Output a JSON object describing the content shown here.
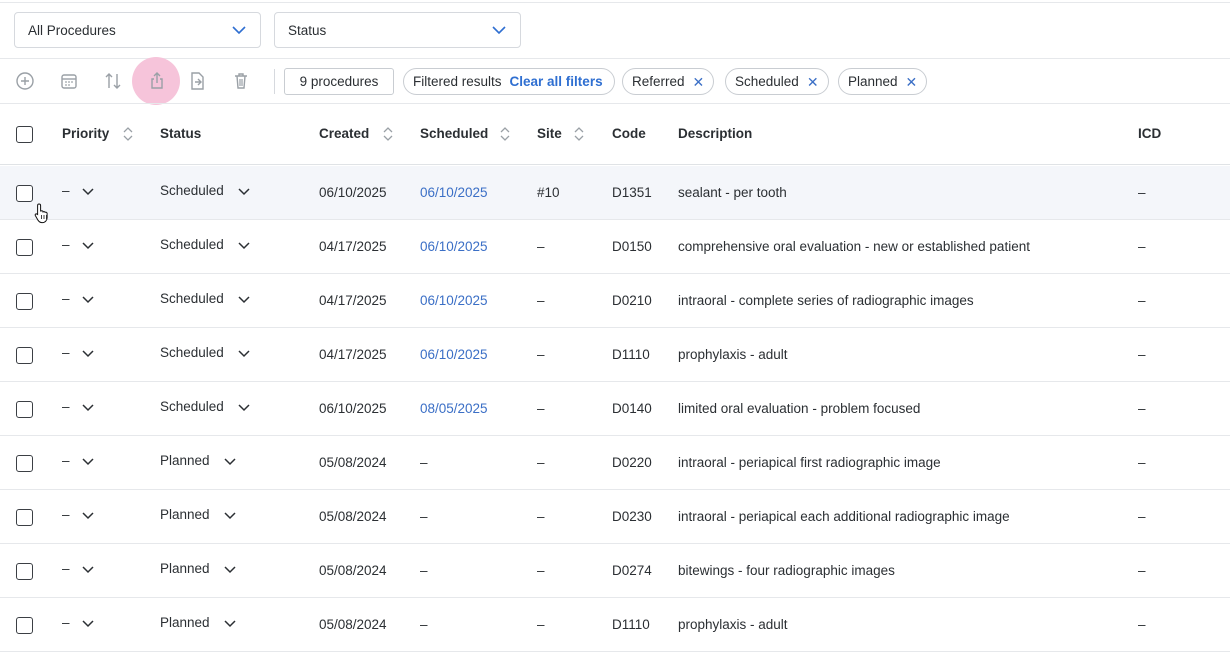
{
  "filters": {
    "procedure_select": "All Procedures",
    "status_select": "Status"
  },
  "toolbar": {
    "icons": [
      "add-icon",
      "calendar-icon",
      "sort-icon",
      "share-icon",
      "export-file-icon",
      "trash-icon"
    ],
    "count_label": "9 procedures",
    "filtered_label": "Filtered results",
    "clear_filters_label": "Clear all filters",
    "active_filters": [
      "Referred",
      "Scheduled",
      "Planned"
    ],
    "remove_icon": "✕"
  },
  "table": {
    "headers": {
      "priority": "Priority",
      "status": "Status",
      "created": "Created",
      "scheduled": "Scheduled",
      "site": "Site",
      "code": "Code",
      "description": "Description",
      "icd": "ICD"
    },
    "rows": [
      {
        "priority": "–",
        "status": "Scheduled",
        "created": "06/10/2025",
        "scheduled": "06/10/2025",
        "site": "#10",
        "code": "D1351",
        "description": "sealant - per tooth",
        "icd": "–"
      },
      {
        "priority": "–",
        "status": "Scheduled",
        "created": "04/17/2025",
        "scheduled": "06/10/2025",
        "site": "–",
        "code": "D0150",
        "description": "comprehensive oral evaluation - new or established patient",
        "icd": "–"
      },
      {
        "priority": "–",
        "status": "Scheduled",
        "created": "04/17/2025",
        "scheduled": "06/10/2025",
        "site": "–",
        "code": "D0210",
        "description": "intraoral - complete series of radiographic images",
        "icd": "–"
      },
      {
        "priority": "–",
        "status": "Scheduled",
        "created": "04/17/2025",
        "scheduled": "06/10/2025",
        "site": "–",
        "code": "D1110",
        "description": "prophylaxis - adult",
        "icd": "–"
      },
      {
        "priority": "–",
        "status": "Scheduled",
        "created": "06/10/2025",
        "scheduled": "08/05/2025",
        "site": "–",
        "code": "D0140",
        "description": "limited oral evaluation - problem focused",
        "icd": "–"
      },
      {
        "priority": "–",
        "status": "Planned",
        "created": "05/08/2024",
        "scheduled": "–",
        "site": "–",
        "code": "D0220",
        "description": "intraoral - periapical first radiographic image",
        "icd": "–"
      },
      {
        "priority": "–",
        "status": "Planned",
        "created": "05/08/2024",
        "scheduled": "–",
        "site": "–",
        "code": "D0230",
        "description": "intraoral - periapical each additional radiographic image",
        "icd": "–"
      },
      {
        "priority": "–",
        "status": "Planned",
        "created": "05/08/2024",
        "scheduled": "–",
        "site": "–",
        "code": "D0274",
        "description": "bitewings - four radiographic images",
        "icd": "–"
      },
      {
        "priority": "–",
        "status": "Planned",
        "created": "05/08/2024",
        "scheduled": "–",
        "site": "–",
        "code": "D1110",
        "description": "prophylaxis - adult",
        "icd": "–"
      }
    ]
  },
  "colors": {
    "accent": "#3b6fc6",
    "highlight": "#f6c4da",
    "hover_row": "#f4f6fa"
  }
}
